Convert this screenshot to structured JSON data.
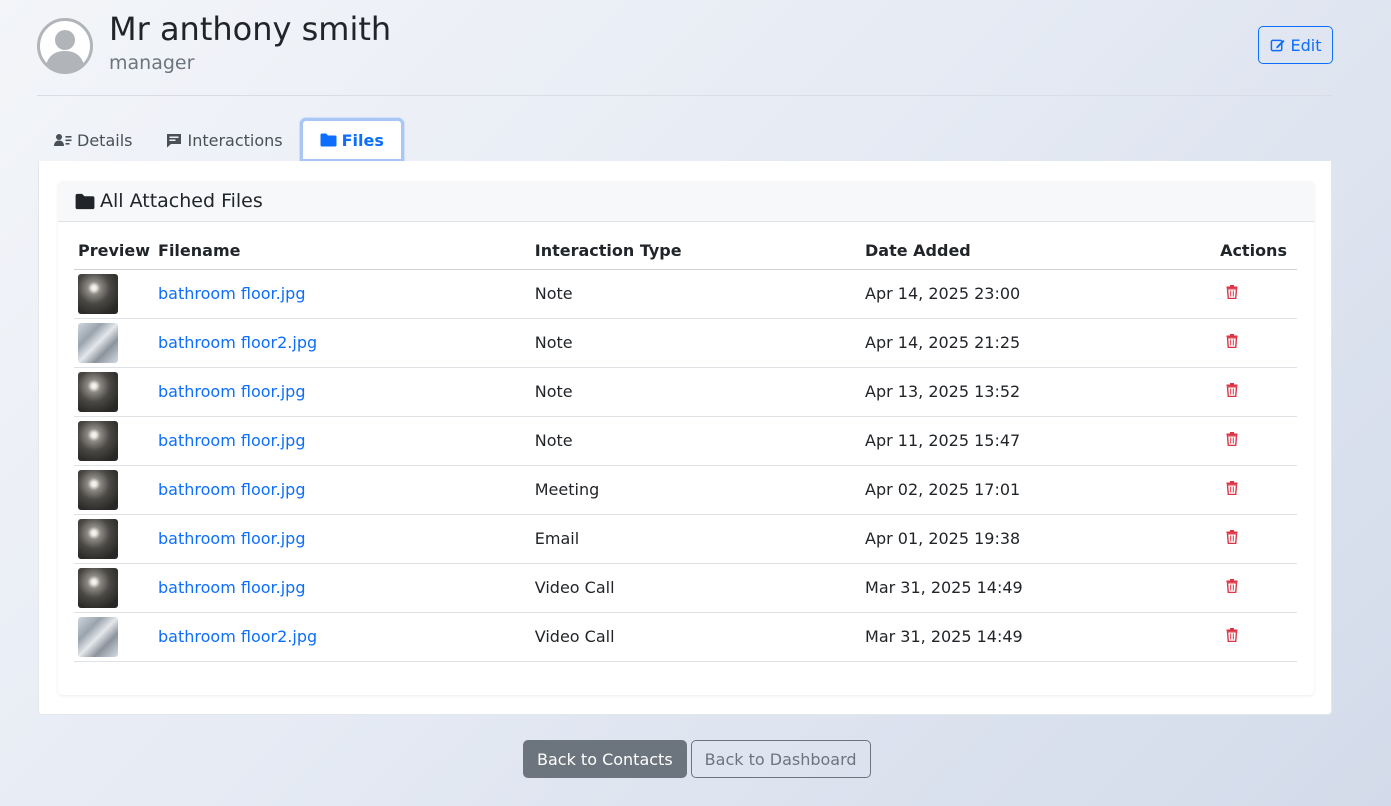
{
  "contact": {
    "name": "Mr anthony smith",
    "role": "manager",
    "edit_label": "Edit"
  },
  "tabs": [
    {
      "label": "Details",
      "icon": "user-details-icon"
    },
    {
      "label": "Interactions",
      "icon": "comment-icon"
    },
    {
      "label": "Files",
      "icon": "folder-icon",
      "active": true
    }
  ],
  "files_card": {
    "title": "All Attached Files",
    "columns": [
      "Preview",
      "Filename",
      "Interaction Type",
      "Date Added",
      "Actions"
    ],
    "rows": [
      {
        "filename": "bathroom floor.jpg",
        "type": "Note",
        "date": "Apr 14, 2025 23:00"
      },
      {
        "filename": "bathroom floor2.jpg",
        "type": "Note",
        "date": "Apr 14, 2025 21:25"
      },
      {
        "filename": "bathroom floor.jpg",
        "type": "Note",
        "date": "Apr 13, 2025 13:52"
      },
      {
        "filename": "bathroom floor.jpg",
        "type": "Note",
        "date": "Apr 11, 2025 15:47"
      },
      {
        "filename": "bathroom floor.jpg",
        "type": "Meeting",
        "date": "Apr 02, 2025 17:01"
      },
      {
        "filename": "bathroom floor.jpg",
        "type": "Email",
        "date": "Apr 01, 2025 19:38"
      },
      {
        "filename": "bathroom floor.jpg",
        "type": "Video Call",
        "date": "Mar 31, 2025 14:49"
      },
      {
        "filename": "bathroom floor2.jpg",
        "type": "Video Call",
        "date": "Mar 31, 2025 14:49"
      }
    ]
  },
  "footer": {
    "back_contacts": "Back to Contacts",
    "back_dashboard": "Back to Dashboard"
  },
  "colors": {
    "accent": "#0d6efd",
    "danger": "#dc3545",
    "secondary": "#6c757d"
  }
}
